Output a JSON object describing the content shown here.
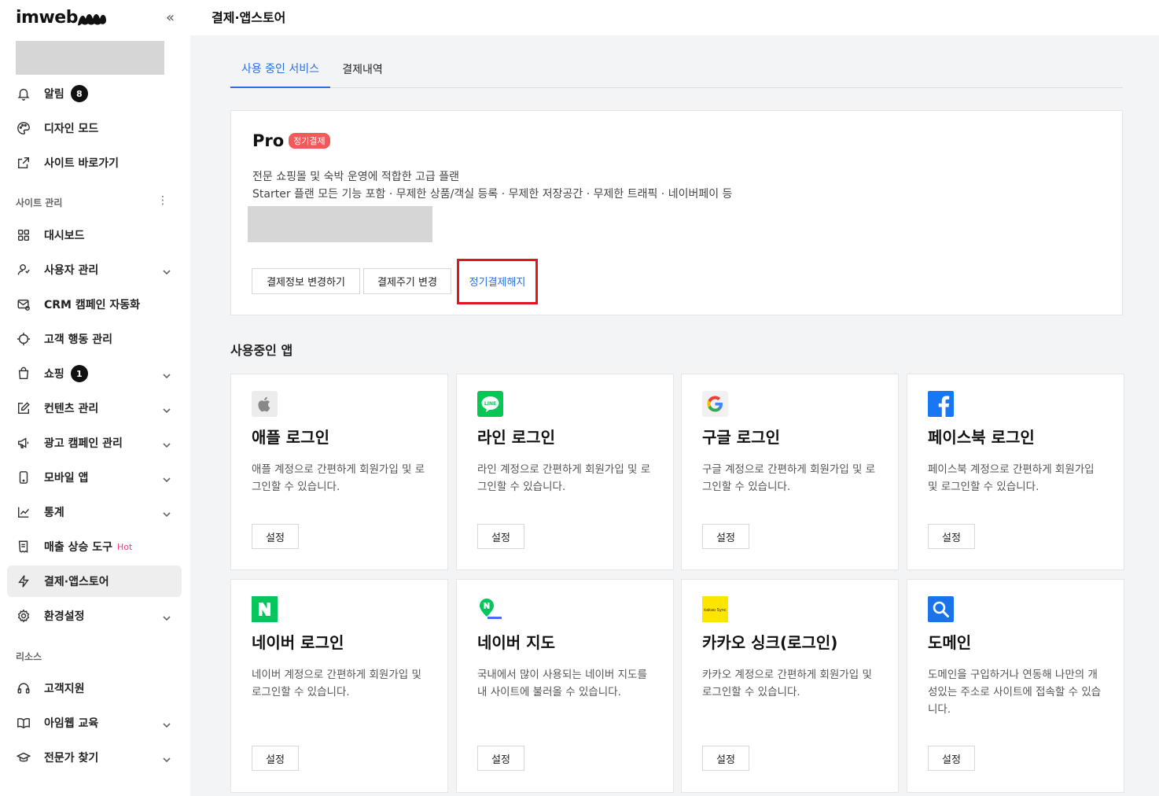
{
  "brand": {
    "logo_text": "imweb"
  },
  "page": {
    "title": "결제·앱스토어"
  },
  "sidebar": {
    "top_items": [
      {
        "label": "알림",
        "badge": "8"
      },
      {
        "label": "디자인 모드"
      },
      {
        "label": "사이트 바로가기"
      }
    ],
    "section_site": "사이트 관리",
    "site_items": [
      {
        "label": "대시보드"
      },
      {
        "label": "사용자 관리"
      },
      {
        "label": "CRM 캠페인 자동화"
      },
      {
        "label": "고객 행동 관리"
      },
      {
        "label": "쇼핑",
        "badge": "1"
      },
      {
        "label": "컨텐츠 관리"
      },
      {
        "label": "광고 캠페인 관리"
      },
      {
        "label": "모바일 앱"
      },
      {
        "label": "통계"
      },
      {
        "label": "매출 상승 도구",
        "tag": "Hot"
      },
      {
        "label": "결제·앱스토어"
      },
      {
        "label": "환경설정"
      }
    ],
    "section_resource": "리소스",
    "resource_items": [
      {
        "label": "고객지원"
      },
      {
        "label": "아임웹 교육"
      },
      {
        "label": "전문가 찾기"
      }
    ]
  },
  "tabs": [
    {
      "label": "사용 중인 서비스",
      "active": true
    },
    {
      "label": "결제내역",
      "active": false
    }
  ],
  "plan": {
    "name": "Pro",
    "tag": "정기결제",
    "desc1": "전문 쇼핑몰 및 숙박 운영에 적합한 고급 플랜",
    "desc2": "Starter 플랜 모든 기능 포함 · 무제한 상품/객실 등록 · 무제한 저장공간 · 무제한 트래픽 · 네이버페이 등",
    "buttons": {
      "change_info": "결제정보 변경하기",
      "change_cycle": "결제주기 변경",
      "cancel": "정기결제해지"
    }
  },
  "apps_heading": "사용중인 앱",
  "apps": [
    {
      "title": "애플 로그인",
      "desc": "애플 계정으로 간편하게 회원가입 및 로그인할 수 있습니다.",
      "button": "설정",
      "icon": "apple-icon"
    },
    {
      "title": "라인 로그인",
      "desc": "라인 계정으로 간편하게 회원가입 및 로그인할 수 있습니다.",
      "button": "설정",
      "icon": "line-icon"
    },
    {
      "title": "구글 로그인",
      "desc": "구글 계정으로 간편하게 회원가입 및 로그인할 수 있습니다.",
      "button": "설정",
      "icon": "google-icon"
    },
    {
      "title": "페이스북 로그인",
      "desc": "페이스북 계정으로 간편하게 회원가입 및 로그인할 수 있습니다.",
      "button": "설정",
      "icon": "facebook-icon"
    },
    {
      "title": "네이버 로그인",
      "desc": "네이버 계정으로 간편하게 회원가입 및 로그인할 수 있습니다.",
      "button": "설정",
      "icon": "naver-icon"
    },
    {
      "title": "네이버 지도",
      "desc": "국내에서 많이 사용되는 네이버 지도를 내 사이트에 불러올 수 있습니다.",
      "button": "설정",
      "icon": "naver-map-icon"
    },
    {
      "title": "카카오 싱크(로그인)",
      "desc": "카카오 계정으로 간편하게 회원가입 및 로그인할 수 있습니다.",
      "button": "설정",
      "icon": "kakao-sync-icon",
      "icon_text": "kakao Sync"
    },
    {
      "title": "도메인",
      "desc": "도메인을 구입하거나 연동해 나만의 개성있는 주소로 사이트에 접속할 수 있습니다.",
      "button": "설정",
      "icon": "domain-search-icon"
    }
  ],
  "colors": {
    "accent": "#2a6ee6",
    "tag_red": "#f05a5a",
    "highlight": "#e0161e",
    "hot": "#f0418c"
  }
}
